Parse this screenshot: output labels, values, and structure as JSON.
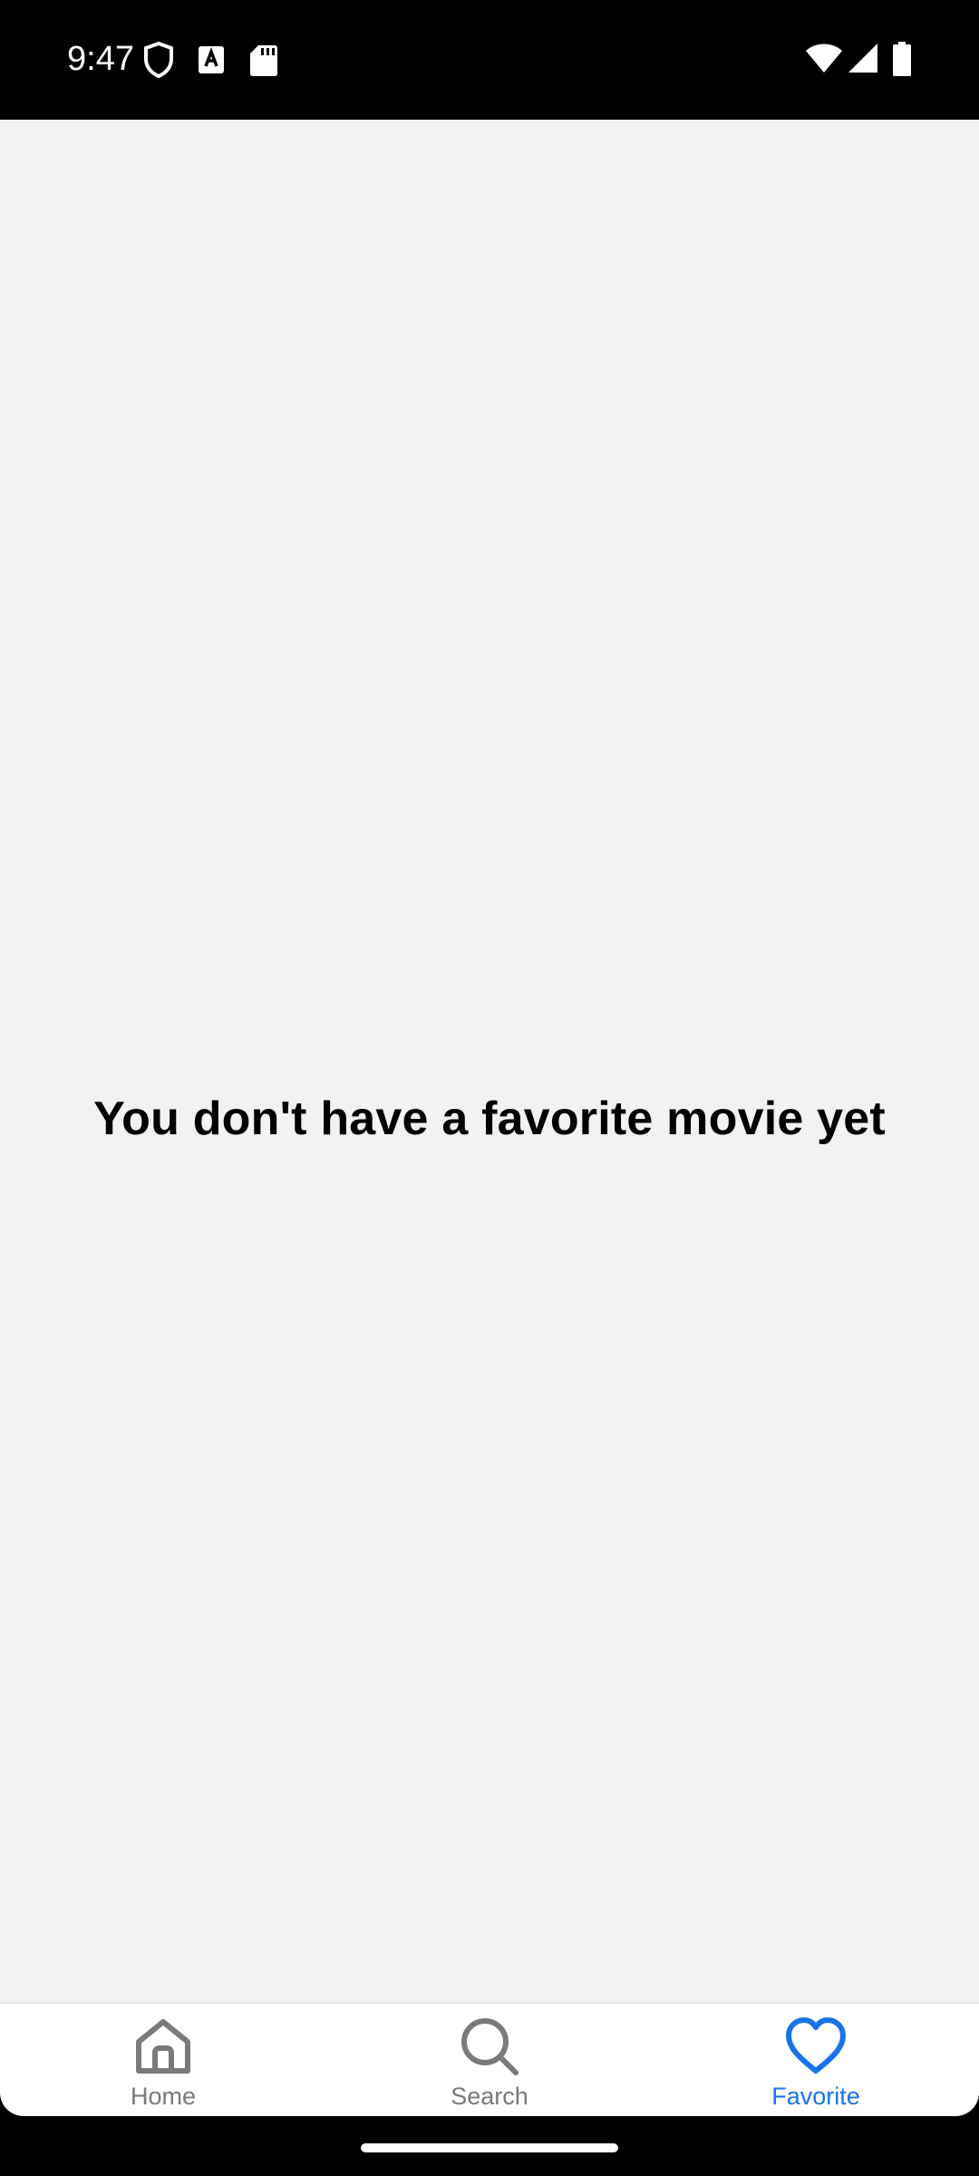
{
  "status_bar": {
    "time": "9:47",
    "left_icons": [
      "shield-icon",
      "a-keyboard-icon",
      "sd-card-icon"
    ],
    "right_icons": [
      "wifi-icon",
      "cell-signal-icon",
      "battery-icon"
    ]
  },
  "main": {
    "empty_message": "You don't have a favorite movie yet"
  },
  "bottom_nav": {
    "items": [
      {
        "label": "Home",
        "icon": "home-icon",
        "active": false
      },
      {
        "label": "Search",
        "icon": "search-icon",
        "active": false
      },
      {
        "label": "Favorite",
        "icon": "heart-icon",
        "active": true
      }
    ]
  },
  "colors": {
    "accent": "#1a73e8",
    "inactive": "#7a7a7a",
    "content_background": "#f2f2f2",
    "status_bar_background": "#000000"
  }
}
